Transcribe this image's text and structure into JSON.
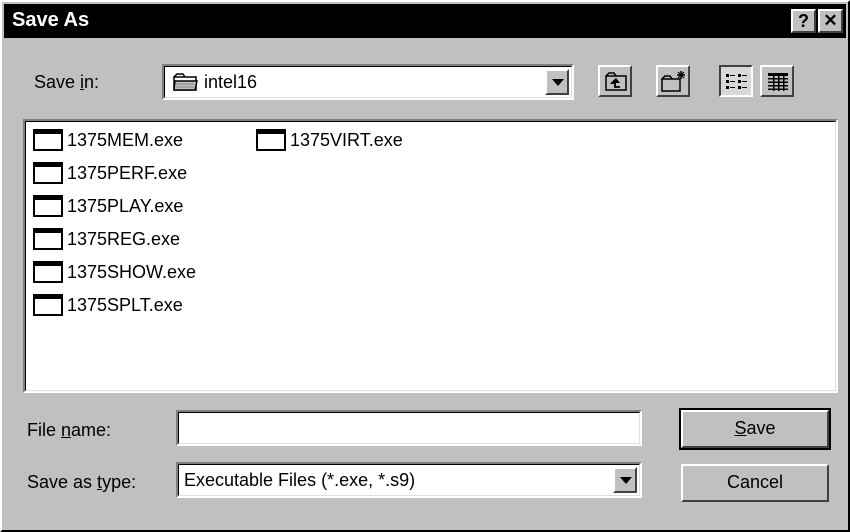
{
  "window": {
    "title": "Save As",
    "help_label": "?",
    "close_label": "✕"
  },
  "save_in": {
    "label_pre": "Save ",
    "label_accel": "i",
    "label_post": "n:",
    "value": "intel16"
  },
  "files": [
    {
      "name": "1375MEM.exe"
    },
    {
      "name": "1375PERF.exe"
    },
    {
      "name": "1375PLAY.exe"
    },
    {
      "name": "1375REG.exe"
    },
    {
      "name": "1375SHOW.exe"
    },
    {
      "name": "1375SPLT.exe"
    },
    {
      "name": "1375VIRT.exe"
    }
  ],
  "file_name": {
    "label_pre": "File ",
    "label_accel": "n",
    "label_post": "ame:",
    "value": ""
  },
  "save_as_type": {
    "label_pre": "Save as ",
    "label_accel": "t",
    "label_post": "ype:",
    "value": "Executable Files (*.exe, *.s9)"
  },
  "buttons": {
    "save_accel": "S",
    "save_rest": "ave",
    "cancel": "Cancel"
  },
  "icons": {
    "folder": "folder-icon",
    "up_one_level": "up-one-level-icon",
    "new_folder": "new-folder-icon",
    "list_view": "list-view-icon",
    "details_view": "details-view-icon",
    "exe_file": "exe-file-icon"
  }
}
